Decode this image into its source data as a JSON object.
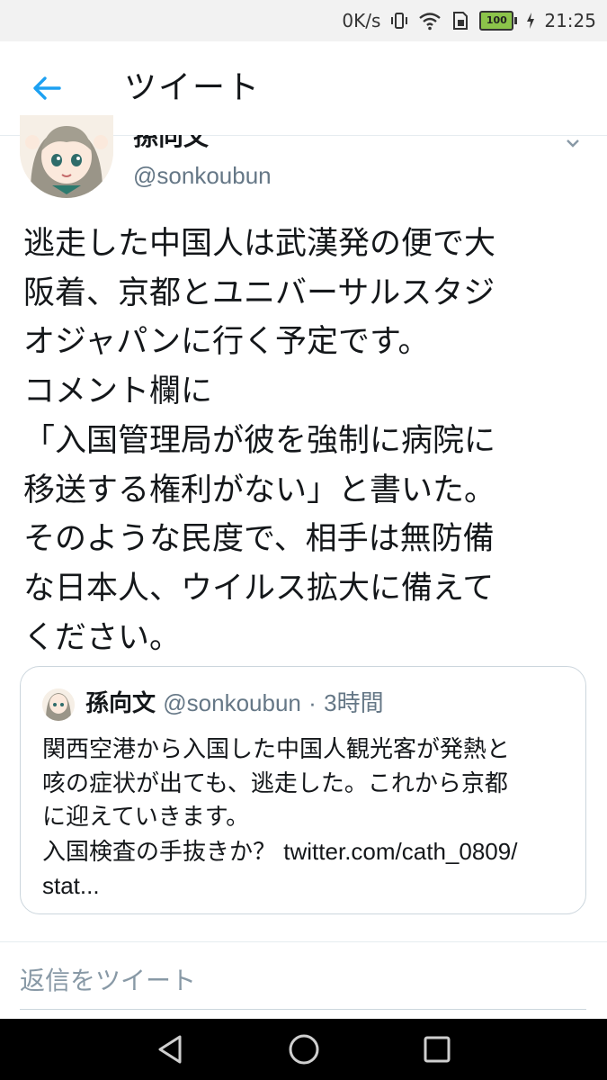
{
  "status_bar": {
    "net_speed": "0K/s",
    "battery_level": "100",
    "time": "21:25",
    "icons": [
      "vibrate-icon",
      "wifi-icon",
      "sim-icon",
      "battery-icon",
      "charging-icon"
    ]
  },
  "header": {
    "back_icon": "arrow-left-icon",
    "title": "ツイート"
  },
  "tweet": {
    "author_name": "孫向文",
    "handle": "@sonkoubun",
    "text_lines": [
      "逃走した中国人は武漢発の便で大",
      "阪着、京都とユニバーサルスタジ",
      "オジャパンに行く予定です。",
      "コメント欄に",
      "「入国管理局が彼を強制に病院に",
      "移送する権利がない」と書いた。",
      "そのような民度で、相手は無防備",
      "な日本人、ウイルス拡大に備えて",
      "ください。"
    ]
  },
  "quoted_tweet": {
    "author_name": "孫向文",
    "handle": "@sonkoubun",
    "separator": "·",
    "time": "3時間",
    "text_lines": [
      "関西空港から入国した中国人観光客が発熱と",
      "咳の症状が出ても、逃走した。これから京都",
      "に迎えていきます。",
      "入国検査の手抜きか？",
      "twitter.com/cath_0809/",
      "stat..."
    ]
  },
  "reply": {
    "placeholder": "返信をツイート"
  },
  "colors": {
    "accent": "#1da1f2",
    "text": "#14171a",
    "muted": "#657786",
    "border": "#ccd6dd",
    "status_bg": "#f2f2f2",
    "nav_bg": "#000000"
  }
}
